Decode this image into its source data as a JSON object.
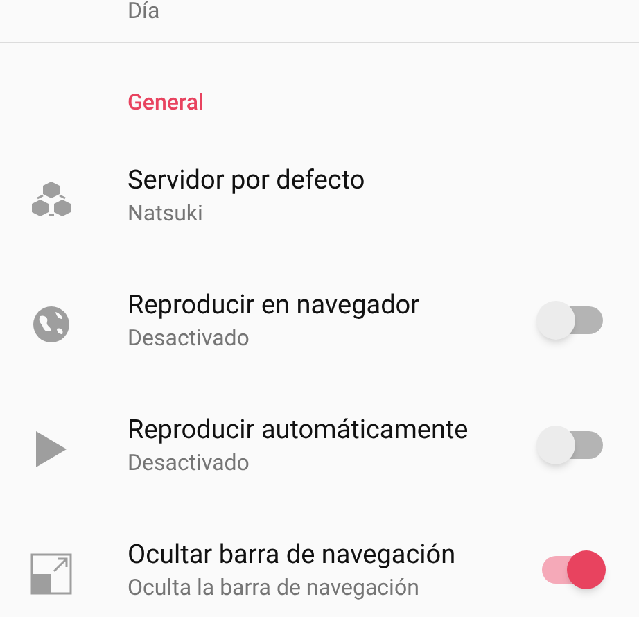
{
  "previous_item": {
    "subtitle": "Día"
  },
  "section": {
    "title": "General"
  },
  "items": [
    {
      "kind": "value",
      "title": "Servidor por defecto",
      "subtitle": "Natsuki"
    },
    {
      "kind": "switch",
      "title": "Reproducir en navegador",
      "subtitle": "Desactivado",
      "on": false
    },
    {
      "kind": "switch",
      "title": "Reproducir automáticamente",
      "subtitle": "Desactivado",
      "on": false
    },
    {
      "kind": "switch",
      "title": "Ocultar barra de navegación",
      "subtitle": "Oculta la barra de navegación",
      "on": true
    }
  ]
}
